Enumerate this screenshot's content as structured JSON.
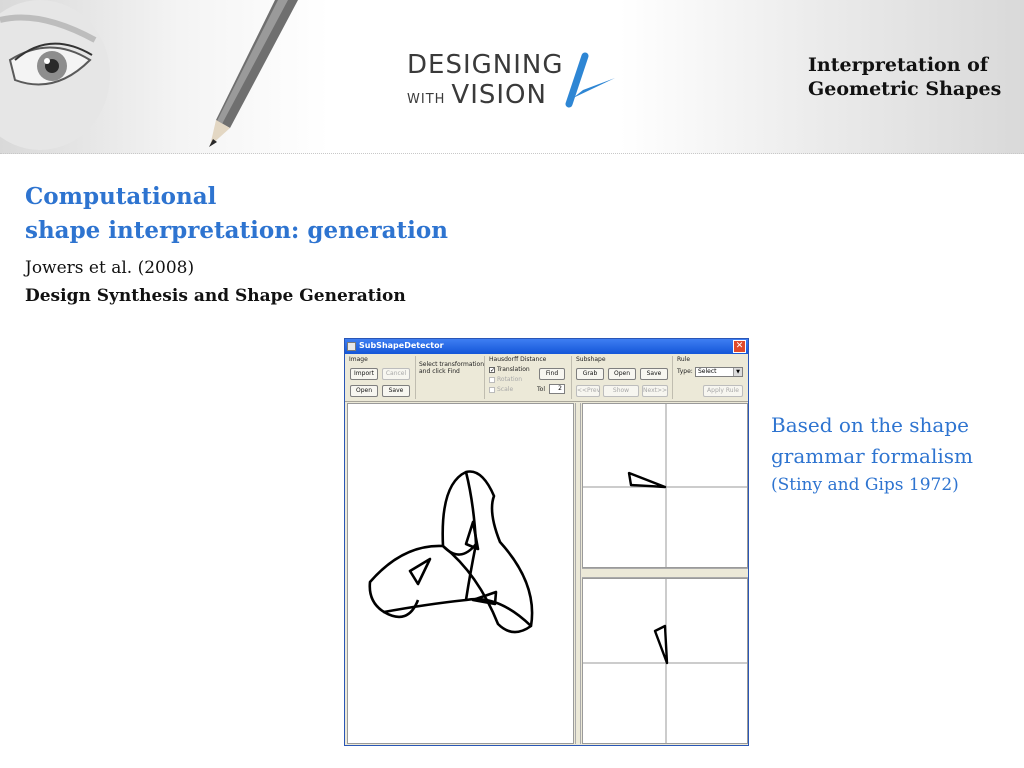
{
  "header": {
    "logo": {
      "line1": "DESIGNING",
      "line2_small": "WITH",
      "line2_big": "VISION"
    },
    "title_line1": "Interpretation of",
    "title_line2": "Geometric Shapes"
  },
  "slide": {
    "heading_line1": "Computational",
    "heading_line2": "shape interpretation: generation",
    "reference_author": "Jowers et al. (2008)",
    "reference_title": "Design Synthesis and Shape Generation",
    "note_line1": "Based on the shape",
    "note_line2": "grammar formalism",
    "note_citation": "(Stiny and Gips 1972)"
  },
  "colors": {
    "accent_blue": "#2e74d0",
    "titlebar_blue": "#1f5fe0",
    "window_face": "#ece9d8"
  },
  "app": {
    "window_title": "SubShapeDetector",
    "close_icon": "close-icon",
    "image_group": {
      "label": "Image",
      "import": "Import",
      "cancel": "Cancel",
      "open": "Open",
      "save": "Save"
    },
    "transform_group": {
      "line1": "Select transformation",
      "line2": "and click Find"
    },
    "hausdorff_group": {
      "label": "Hausdorff Distance",
      "translation": "Translation",
      "rotation": "Rotation",
      "scale": "Scale",
      "find": "Find",
      "tol_label": "Tol",
      "tol_value": "2"
    },
    "subshape_group": {
      "label": "Subshape",
      "grab": "Grab",
      "open": "Open",
      "save": "Save",
      "prev": "<<Prev",
      "show": "Show",
      "next": "Next>>"
    },
    "rule_group": {
      "label": "Rule",
      "type_label": "Type:",
      "type_value": "Select",
      "apply": "Apply Rule"
    }
  }
}
